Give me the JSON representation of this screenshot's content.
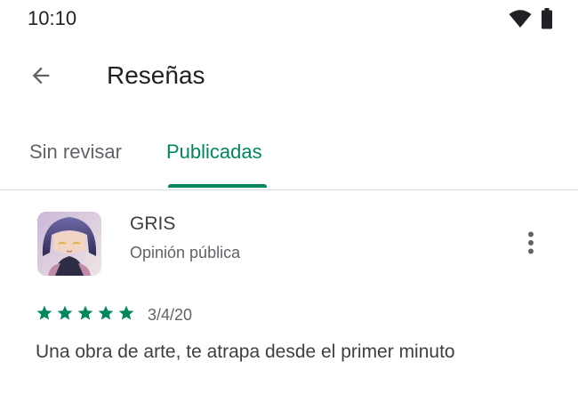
{
  "status_bar": {
    "time": "10:10",
    "icons": [
      "wifi-icon",
      "battery-icon"
    ]
  },
  "app_bar": {
    "back_icon": "arrow-back-icon",
    "title": "Reseñas"
  },
  "tabs": [
    {
      "label": "Sin revisar",
      "selected": false
    },
    {
      "label": "Publicadas",
      "selected": true
    }
  ],
  "colors": {
    "accent": "#01875f",
    "text_primary": "#202124",
    "text_secondary": "#5f6368",
    "divider": "#dadce0"
  },
  "review": {
    "app_name": "GRIS",
    "review_type": "Opinión pública",
    "rating": 5,
    "rating_max": 5,
    "date": "3/4/20",
    "text": "Una obra de arte, te atrapa desde el primer minuto",
    "menu_icon": "more-vert-icon"
  }
}
